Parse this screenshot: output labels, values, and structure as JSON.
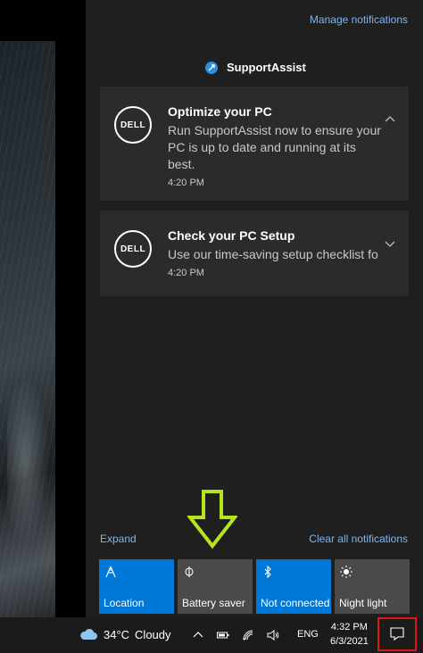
{
  "action_center": {
    "manage_label": "Manage notifications",
    "app_name": "SupportAssist",
    "notifications": [
      {
        "logo": "DELL",
        "title": "Optimize your PC",
        "body": "Run SupportAssist now to ensure your PC is up to date and running at its best.",
        "time": "4:20 PM"
      },
      {
        "logo": "DELL",
        "title": "Check your PC Setup",
        "body": "Use our time-saving setup checklist fo",
        "time": "4:20 PM"
      }
    ],
    "expand_label": "Expand",
    "clear_label": "Clear all notifications",
    "quick_actions": [
      {
        "label": "Location",
        "icon": "location-icon",
        "state": "on"
      },
      {
        "label": "Battery saver",
        "icon": "battery-saver-icon",
        "state": "off"
      },
      {
        "label": "Not connected",
        "icon": "bluetooth-icon",
        "state": "on"
      },
      {
        "label": "Night light",
        "icon": "night-light-icon",
        "state": "off"
      }
    ]
  },
  "taskbar": {
    "weather_temp": "34°C",
    "weather_text": "Cloudy",
    "language": "ENG",
    "time": "4:32 PM",
    "date": "6/3/2021"
  },
  "colors": {
    "accent": "#0078d7",
    "link": "#7fb6ee",
    "highlight_box": "#e0161b",
    "annotation_arrow": "#b5e61d"
  }
}
